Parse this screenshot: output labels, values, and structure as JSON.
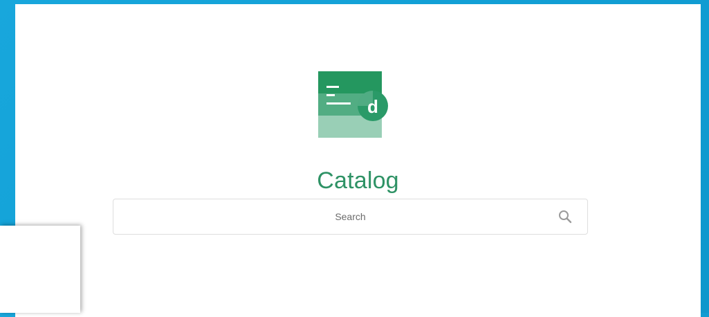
{
  "app": {
    "title": "Catalog",
    "logo_icon": "catalog-d-logo-icon",
    "logo_letter": "d"
  },
  "search": {
    "placeholder": "Search",
    "value": "",
    "icon": "search-icon"
  },
  "colors": {
    "background_accent": "#18a7dc",
    "brand_green": "#2e9265",
    "logo_dark": "#24975f",
    "logo_mid": "#52ad83",
    "logo_light": "#99cfb6"
  }
}
